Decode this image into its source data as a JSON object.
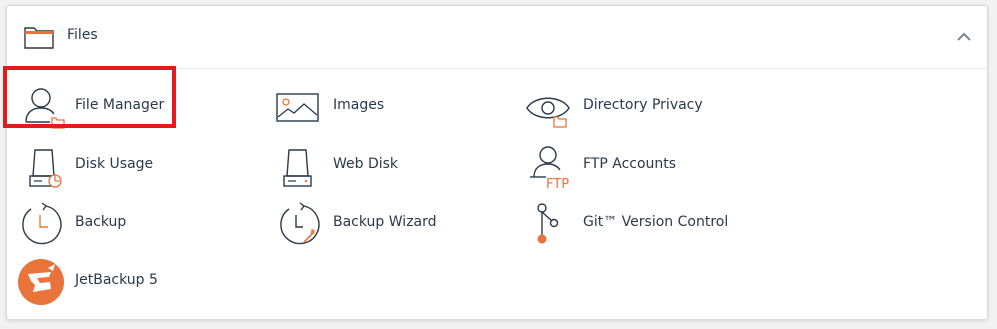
{
  "section": {
    "title": "Files",
    "icon": "folder-icon",
    "collapse_icon": "chevron-up-icon"
  },
  "colors": {
    "text": "#293a4a",
    "accent_orange": "#e8743b",
    "highlight_red": "#e31b1b"
  },
  "items": [
    {
      "label": "File Manager",
      "icon": "file-manager-icon",
      "highlighted": true
    },
    {
      "label": "Images",
      "icon": "images-icon"
    },
    {
      "label": "Directory Privacy",
      "icon": "directory-privacy-icon"
    },
    {
      "label": "Disk Usage",
      "icon": "disk-usage-icon"
    },
    {
      "label": "Web Disk",
      "icon": "web-disk-icon"
    },
    {
      "label": "FTP Accounts",
      "icon": "ftp-accounts-icon",
      "icon_text": "FTP"
    },
    {
      "label": "Backup",
      "icon": "backup-icon"
    },
    {
      "label": "Backup Wizard",
      "icon": "backup-wizard-icon"
    },
    {
      "label": "Git™ Version Control",
      "icon": "git-icon"
    },
    {
      "label": "JetBackup 5",
      "icon": "jetbackup-icon"
    }
  ]
}
